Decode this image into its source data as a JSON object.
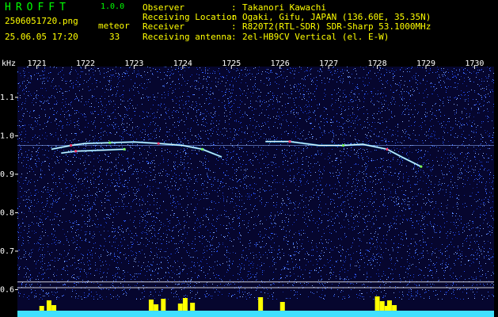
{
  "app": {
    "title": "HROFFT",
    "version": "1.0.0"
  },
  "file_name": "2506051720.png",
  "datetime": "25.06.05 17:20",
  "meteor": {
    "label": "meteor",
    "count": "33"
  },
  "info": [
    {
      "key": "Observer",
      "value": "Takanori Kawachi"
    },
    {
      "key": "Receiving Location",
      "value": "Ogaki, Gifu, JAPAN (136.60E, 35.35N)"
    },
    {
      "key": "Receiver",
      "value": "R820T2(RTL-SDR) SDR-Sharp 53.1000MHz"
    },
    {
      "key": "Receiving antenna",
      "value": "2el-HB9CV Vertical (el. E-W)"
    }
  ],
  "info_separator": ":",
  "colors": {
    "background": "#000000",
    "spectrogram": "#06062e",
    "noise": "#2a55ff",
    "label": "#ffff00",
    "title": "#00ff00",
    "trace": "#ffffff"
  },
  "chart_data": {
    "type": "heatmap",
    "y_unit": "kHz",
    "x": {
      "ticks": [
        "1721",
        "1722",
        "1723",
        "1724",
        "1725",
        "1726",
        "1727",
        "1728",
        "1729",
        "1730"
      ],
      "range": [
        1720.6,
        1730.4
      ]
    },
    "y": {
      "ticks": [
        "1.1",
        "1.0",
        "0.9",
        "0.8",
        "0.7",
        "0.6"
      ],
      "range": [
        0.57,
        1.18
      ]
    },
    "reference_lines_khz": [
      0.975,
      0.62,
      0.605
    ],
    "echo_traces": [
      {
        "points": [
          [
            1721.3,
            0.965
          ],
          [
            1721.7,
            0.975
          ],
          [
            1722.0,
            0.98
          ],
          [
            1722.5,
            0.982
          ],
          [
            1723.0,
            0.984
          ],
          [
            1723.5,
            0.98
          ],
          [
            1724.0,
            0.975
          ],
          [
            1724.4,
            0.965
          ],
          [
            1724.8,
            0.945
          ]
        ]
      },
      {
        "points": [
          [
            1721.5,
            0.955
          ],
          [
            1721.8,
            0.96
          ],
          [
            1722.2,
            0.962
          ],
          [
            1722.8,
            0.965
          ]
        ]
      },
      {
        "points": [
          [
            1725.7,
            0.985
          ],
          [
            1726.2,
            0.985
          ],
          [
            1726.8,
            0.975
          ],
          [
            1727.3,
            0.975
          ],
          [
            1727.7,
            0.978
          ],
          [
            1728.2,
            0.965
          ],
          [
            1728.5,
            0.945
          ],
          [
            1728.9,
            0.92
          ]
        ]
      }
    ],
    "echo_bursts_x": [
      1721.1,
      1721.25,
      1721.35,
      1723.35,
      1723.45,
      1723.6,
      1723.95,
      1724.05,
      1724.2,
      1725.6,
      1726.05,
      1728.0,
      1728.1,
      1728.2,
      1728.25,
      1728.35
    ]
  }
}
